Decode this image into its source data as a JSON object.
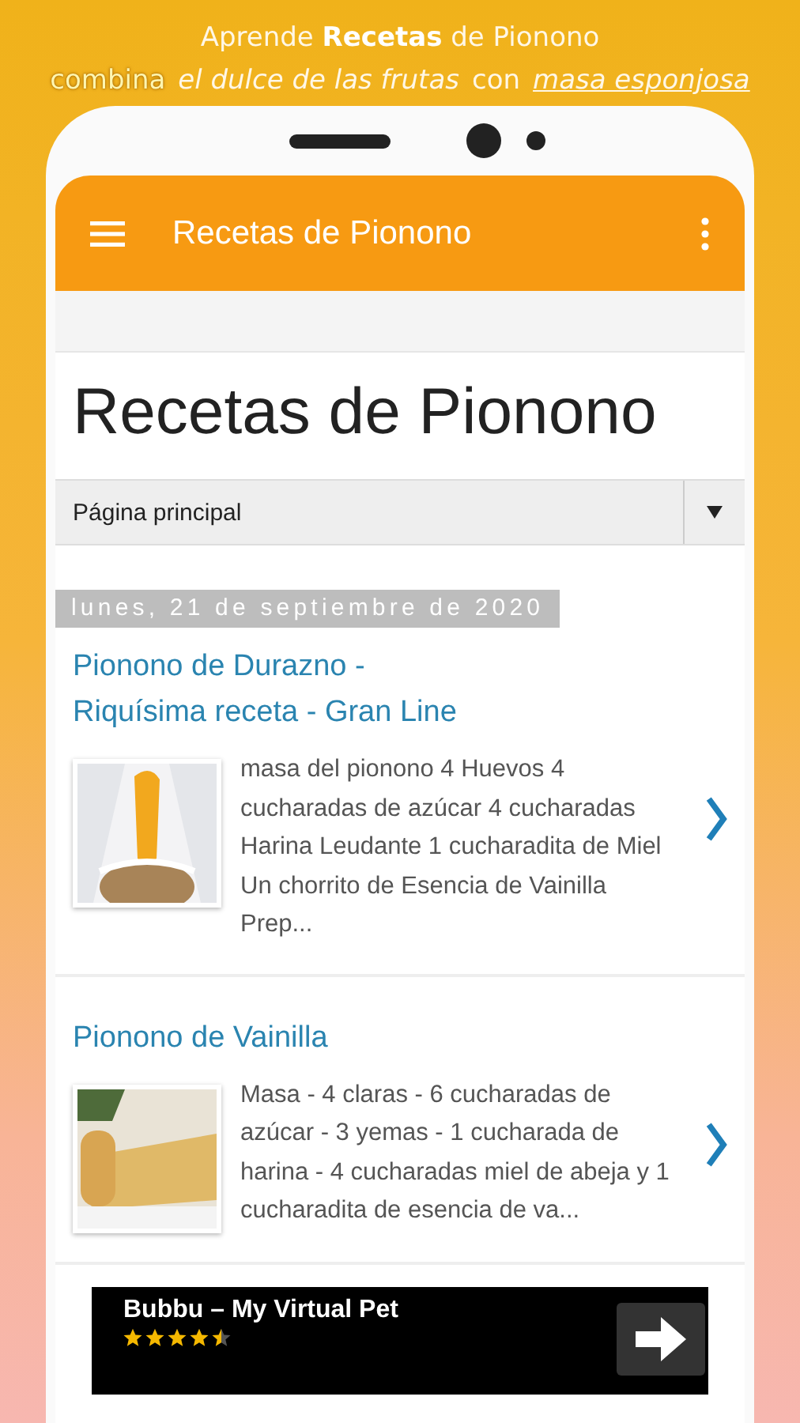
{
  "headline": [
    [
      {
        "text": "Aprende ",
        "kind": "plain"
      },
      {
        "text": "Recetas",
        "kind": "bold"
      },
      {
        "text": " de Pionono",
        "kind": "plain"
      }
    ],
    [
      {
        "text": "combina",
        "kind": "accent"
      },
      {
        "text": "el dulce de las frutas",
        "kind": "italic"
      },
      {
        "text": "con",
        "kind": "plain"
      },
      {
        "text": "masa  esponjosa",
        "kind": "underline"
      }
    ]
  ],
  "app_bar": {
    "title": "Recetas de Pionono"
  },
  "blog_title": "Recetas de Pionono",
  "page_select": {
    "value": "Página principal"
  },
  "date": "lunes, 21 de septiembre de 2020",
  "posts": [
    {
      "title": "Pionono de Durazno -\nRiquísima receta - Gran Line",
      "snippet": "masa del pionono  4 Huevos 4 cucharadas de azúcar 4 cucharadas Harina Leudante 1 cucharadita de Miel Un chorrito de Esencia de Vainilla Prep..."
    },
    {
      "title": "Pionono de Vainilla",
      "snippet": "Masa - 4 claras - 6 cucharadas de azúcar - 3 yemas - 1 cucharada de harina - 4 cucharadas miel de abeja y 1 cucharadita de esencia de va..."
    }
  ],
  "ad": {
    "title": "Bubbu – My Virtual Pet",
    "stars": 4.5
  }
}
